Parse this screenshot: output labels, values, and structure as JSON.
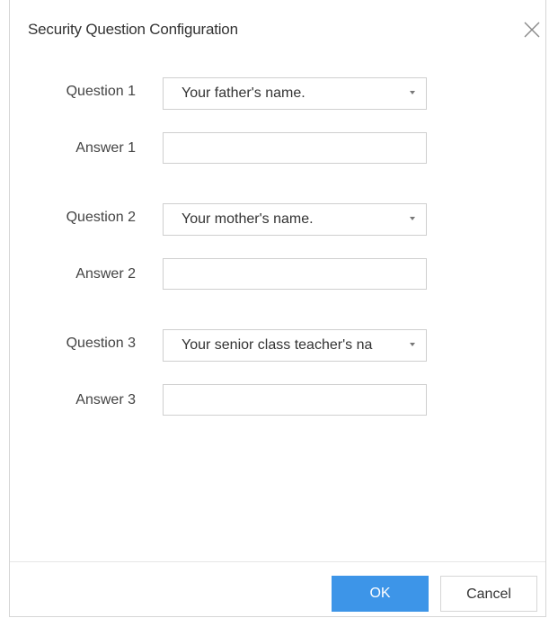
{
  "dialog": {
    "title": "Security Question Configuration",
    "close_icon": "close-icon"
  },
  "rows": [
    {
      "question_label": "Question 1",
      "question_value": "Your father's name.",
      "answer_label": "Answer 1",
      "answer_value": ""
    },
    {
      "question_label": "Question 2",
      "question_value": "Your mother's name.",
      "answer_label": "Answer 2",
      "answer_value": ""
    },
    {
      "question_label": "Question 3",
      "question_value": "Your senior class teacher's na",
      "answer_label": "Answer 3",
      "answer_value": ""
    }
  ],
  "footer": {
    "ok_label": "OK",
    "cancel_label": "Cancel"
  },
  "colors": {
    "primary": "#3d95e8",
    "border": "#cfcfcf"
  }
}
